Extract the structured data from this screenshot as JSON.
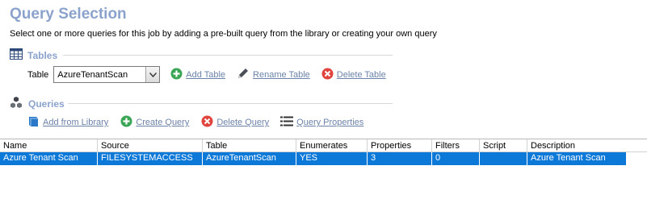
{
  "header": {
    "title": "Query Selection",
    "subtitle": "Select one or more queries for this job by adding a pre-built query from the library or creating your own query"
  },
  "tables_section": {
    "label": "Tables",
    "table_label": "Table",
    "selected_table": "AzureTenantScan",
    "add_label": "Add Table",
    "rename_label": "Rename Table",
    "delete_label": "Delete Table"
  },
  "queries_section": {
    "label": "Queries",
    "add_from_library_label": "Add from Library",
    "create_label": "Create Query",
    "delete_label": "Delete Query",
    "properties_label": "Query Properties"
  },
  "grid": {
    "columns": [
      "Name",
      "Source",
      "Table",
      "Enumerates",
      "Properties",
      "Filters",
      "Script",
      "Description"
    ],
    "rows": [
      [
        "Azure Tenant Scan",
        "FILESYSTEMACCESS",
        "AzureTenantScan",
        "YES",
        "3",
        "0",
        "",
        "Azure Tenant Scan"
      ]
    ]
  },
  "colors": {
    "title": "#8ba3cc",
    "link": "#6b83a8",
    "selection": "#0c78d8",
    "add_icon": "#3aa655",
    "delete_icon": "#e0443c"
  }
}
